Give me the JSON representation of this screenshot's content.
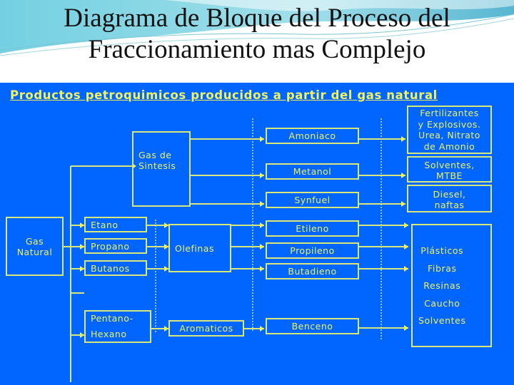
{
  "slide_title": "Diagrama de Bloque del Proceso del Fraccionamiento mas Complejo",
  "diagram_title": "Productos petroquimicos producidos a partir del gas natural",
  "colors": {
    "panel_background": "#0066ff",
    "box_border": "#d6e87a",
    "text": "#f2f25a"
  },
  "nodes": {
    "gas_natural": "Gas\nNatural",
    "gas_sintesis": "Gas de\nSintesis",
    "etano": "Etano",
    "propano": "Propano",
    "butanos": "Butanos",
    "pentano_hexano": "Pentano-\nHexano",
    "olefinas": "Olefinas",
    "aromaticos": "Aromaticos",
    "amoniaco": "Amoniaco",
    "metanol": "Metanol",
    "synfuel": "Synfuel",
    "etileno": "Etileno",
    "propileno": "Propileno",
    "butadieno": "Butadieno",
    "benceno": "Benceno",
    "fertilizantes": "Fertilizantes\ny Explosivos.\nUrea, Nitrato\nde Amonio",
    "solventes_mtbe": "Solventes,\nMTBE",
    "diesel": "Diesel,\nnaftas"
  },
  "end_products": [
    "Plásticos",
    "Fibras",
    "Resinas",
    "Caucho",
    "Solventes"
  ]
}
